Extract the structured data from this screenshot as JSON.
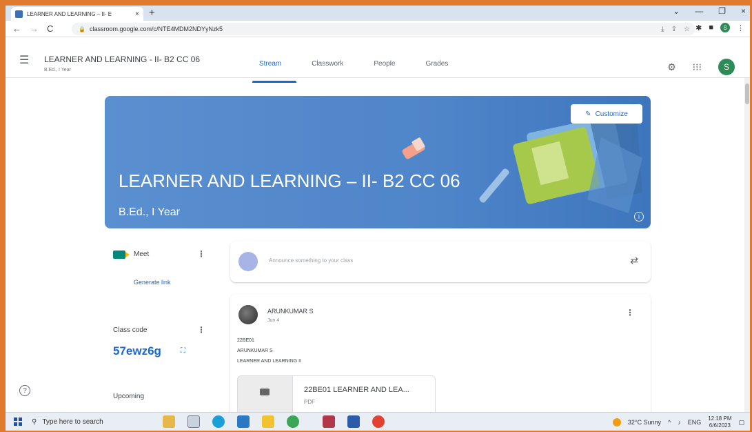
{
  "browser": {
    "tab_title": "LEARNER AND LEARNING – II- E",
    "tab_close": "×",
    "new_tab": "+",
    "url": "classroom.google.com/c/NTE4MDM2NDYyNzk5",
    "profile_initial": "S",
    "window_controls": [
      "⌄",
      "—",
      "❐",
      "×"
    ]
  },
  "header": {
    "course_title": "LEARNER AND LEARNING - II- B2 CC 06",
    "course_subtitle": "B.Ed., I Year",
    "tabs": [
      {
        "label": "Stream",
        "active": true
      },
      {
        "label": "Classwork"
      },
      {
        "label": "People"
      },
      {
        "label": "Grades"
      }
    ],
    "avatar_initial": "S"
  },
  "banner": {
    "title": "LEARNER AND LEARNING – II- B2 CC 06",
    "subtitle": "B.Ed., I Year",
    "customize_label": "Customize",
    "info_icon": "i",
    "color": "#4f85c9"
  },
  "sidebar": {
    "meet_label": "Meet",
    "generate_link": "Generate link",
    "class_code_label": "Class code",
    "class_code": "57ewz6g",
    "upcoming_label": "Upcoming"
  },
  "stream": {
    "announce_placeholder": "Announce something to your class",
    "post": {
      "author": "ARUNKUMAR S",
      "date": "Jun 4",
      "lines": [
        "22BE01",
        "ARUNKUMAR S",
        "LEARNER AND LEARNING II"
      ],
      "attachment_name": "22BE01 LEARNER AND LEA...",
      "attachment_type": "PDF"
    }
  },
  "taskbar": {
    "search_placeholder": "Type here to search",
    "weather": "32°C Sunny",
    "language": "ENG",
    "time": "12:18 PM",
    "date": "6/6/2023"
  },
  "colors": {
    "accent": "#1967d2",
    "frame": "#e07a2e"
  }
}
